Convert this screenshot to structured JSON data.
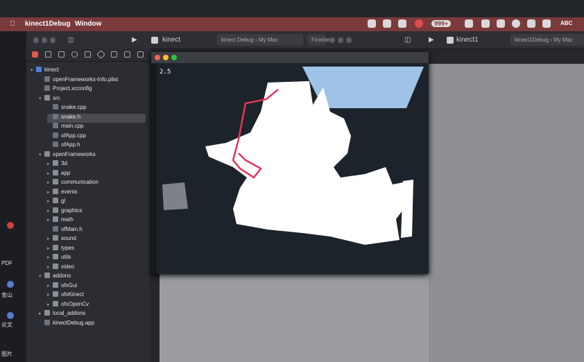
{
  "menubar": {
    "app_name": "kinect1Debug",
    "window_menu": "Window",
    "badge_count": "999+",
    "input_method": "ABC"
  },
  "xcode": {
    "toolbar": {
      "scheme": "kinect",
      "tab1": "kinect Debug",
      "tab2": "My Mac",
      "tab3": "Finished",
      "scheme2": "kinect1",
      "tab4": "kinect1Debug",
      "tab5": "My Mac"
    }
  },
  "navigator": {
    "items": [
      {
        "label": "kinect",
        "type": "project",
        "indent": 0,
        "disclosure": "open"
      },
      {
        "label": "openFrameworks-Info.plist",
        "type": "file",
        "indent": 1
      },
      {
        "label": "Project.xcconfig",
        "type": "file",
        "indent": 1
      },
      {
        "label": "src",
        "type": "folder",
        "indent": 1,
        "disclosure": "open"
      },
      {
        "label": "snake.cpp",
        "type": "file",
        "indent": 2
      },
      {
        "label": "snake.h",
        "type": "file",
        "indent": 2,
        "selected": true
      },
      {
        "label": "main.cpp",
        "type": "file",
        "indent": 2
      },
      {
        "label": "ofApp.cpp",
        "type": "file",
        "indent": 2
      },
      {
        "label": "ofApp.h",
        "type": "file",
        "indent": 2
      },
      {
        "label": "openFrameworks",
        "type": "folder",
        "indent": 1,
        "disclosure": "open"
      },
      {
        "label": "3d",
        "type": "folder",
        "indent": 2,
        "disclosure": "closed"
      },
      {
        "label": "app",
        "type": "folder",
        "indent": 2,
        "disclosure": "closed"
      },
      {
        "label": "communication",
        "type": "folder",
        "indent": 2,
        "disclosure": "closed"
      },
      {
        "label": "events",
        "type": "folder",
        "indent": 2,
        "disclosure": "closed"
      },
      {
        "label": "gl",
        "type": "folder",
        "indent": 2,
        "disclosure": "closed"
      },
      {
        "label": "graphics",
        "type": "folder",
        "indent": 2,
        "disclosure": "closed"
      },
      {
        "label": "math",
        "type": "folder",
        "indent": 2,
        "disclosure": "closed"
      },
      {
        "label": "ofMain.h",
        "type": "file",
        "indent": 2
      },
      {
        "label": "sound",
        "type": "folder",
        "indent": 2,
        "disclosure": "closed"
      },
      {
        "label": "types",
        "type": "folder",
        "indent": 2,
        "disclosure": "closed"
      },
      {
        "label": "utils",
        "type": "folder",
        "indent": 2,
        "disclosure": "closed"
      },
      {
        "label": "video",
        "type": "folder",
        "indent": 2,
        "disclosure": "closed"
      },
      {
        "label": "addons",
        "type": "folder",
        "indent": 1,
        "disclosure": "open"
      },
      {
        "label": "ofxGui",
        "type": "folder",
        "indent": 2,
        "disclosure": "closed"
      },
      {
        "label": "ofxKinect",
        "type": "folder",
        "indent": 2,
        "disclosure": "closed"
      },
      {
        "label": "ofxOpenCv",
        "type": "folder",
        "indent": 2,
        "disclosure": "closed"
      },
      {
        "label": "local_addons",
        "type": "folder",
        "indent": 1,
        "disclosure": "closed"
      },
      {
        "label": "kinectDebug.app",
        "type": "file",
        "indent": 1
      }
    ]
  },
  "app_window": {
    "fps_text": "2.5"
  },
  "desktop": {
    "labels": [
      "PDF",
      "金山",
      "论文",
      "图片"
    ]
  },
  "colors": {
    "menubar": "#7a3a3c",
    "depth_blob": "#ffffff",
    "snake_line": "#e8335a",
    "sidebar": "#2b2d32"
  }
}
